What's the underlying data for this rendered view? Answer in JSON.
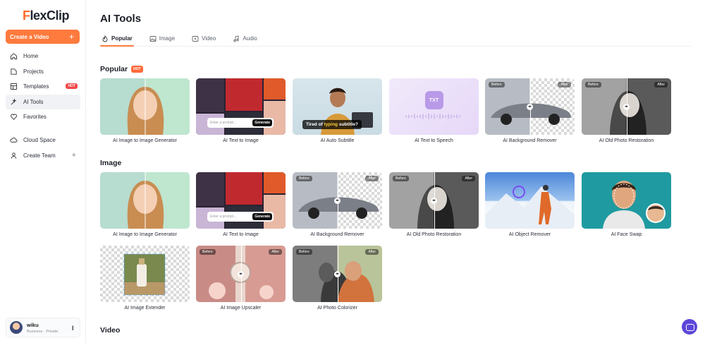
{
  "app": {
    "logo_first": "F",
    "logo_rest": "lexClip",
    "accent": "#ff7a3d"
  },
  "sidebar": {
    "create_label": "Create a Video",
    "items": [
      {
        "label": "Home",
        "icon": "home-icon"
      },
      {
        "label": "Projects",
        "icon": "projects-icon"
      },
      {
        "label": "Templates",
        "icon": "templates-icon",
        "badge": "HOT"
      },
      {
        "label": "AI Tools",
        "icon": "ai-tools-icon",
        "active": true
      },
      {
        "label": "Favorites",
        "icon": "heart-icon"
      },
      {
        "label": "Cloud Space",
        "icon": "cloud-icon"
      },
      {
        "label": "Create Team",
        "icon": "team-icon"
      }
    ],
    "user": {
      "name": "wiku",
      "plan": "Business · Private"
    }
  },
  "main": {
    "title": "AI Tools",
    "tabs": [
      "Popular",
      "Image",
      "Video",
      "Audio"
    ],
    "sections": {
      "popular": {
        "title": "Popular",
        "badge": "HOT"
      },
      "image": {
        "title": "Image"
      },
      "video": {
        "title": "Video"
      }
    },
    "popular_cards": [
      "AI Image to Image Generator",
      "AI Text to Image",
      "AI Auto Subtitle",
      "AI Text to Speech",
      "AI Background Remover",
      "AI Old Photo Restoration"
    ],
    "image_cards": [
      "AI Image to Image Generator",
      "AI Text to Image",
      "AI Background Remover",
      "AI Old Photo Restoration",
      "AI Object Remover",
      "AI Face Swap",
      "AI Image Extender",
      "AI Image Upscaler",
      "AI Photo Colorizer"
    ],
    "thumb_text": {
      "before": "Before",
      "after": "After",
      "prompt_placeholder": "Enter a prompt...",
      "generate": "Generate",
      "subtitle_pre": "Tired of ",
      "subtitle_hl": "typing",
      "subtitle_post": " subtitle?",
      "txt": "TXT",
      "handle": "◂▸"
    }
  }
}
